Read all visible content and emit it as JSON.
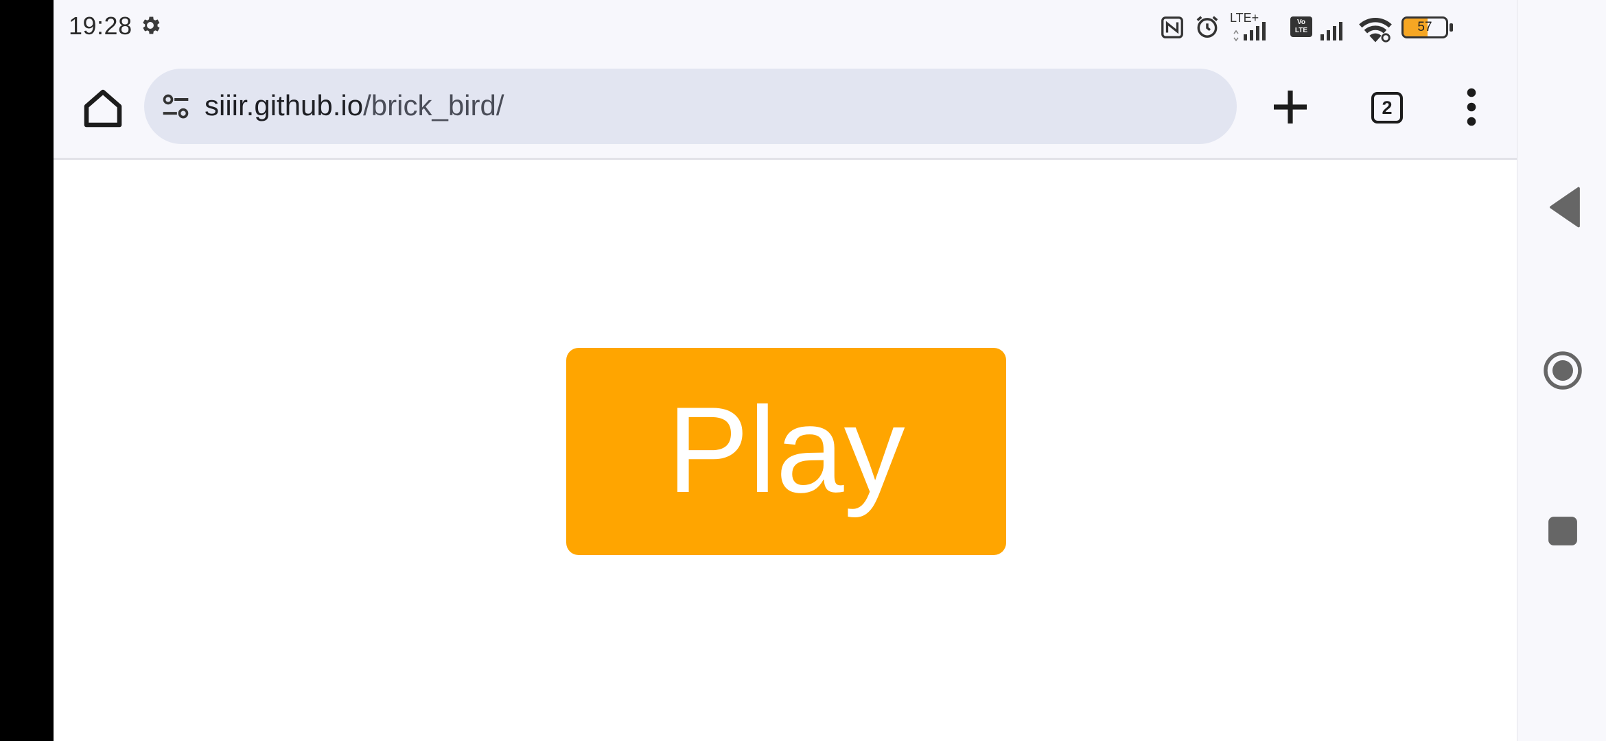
{
  "status_bar": {
    "time": "19:28",
    "network_label": "LTE+",
    "volte_label": "Vo LTE",
    "battery_level": "57",
    "icons": [
      "gear-icon",
      "nfc-icon",
      "alarm-icon",
      "signal-icon",
      "volte-icon",
      "signal-icon",
      "wifi-icon",
      "battery-icon"
    ]
  },
  "toolbar": {
    "url_domain": "siiir.github.io",
    "url_path": "/brick_bird/",
    "tab_count": "2",
    "icons": [
      "home-icon",
      "site-settings-icon",
      "plus-icon",
      "tabs-icon",
      "more-vert-icon"
    ]
  },
  "page": {
    "play_label": "Play",
    "play_color": "#ffa500"
  },
  "nav": {
    "icons": [
      "back-icon",
      "home-circle-icon",
      "recent-apps-icon"
    ]
  }
}
